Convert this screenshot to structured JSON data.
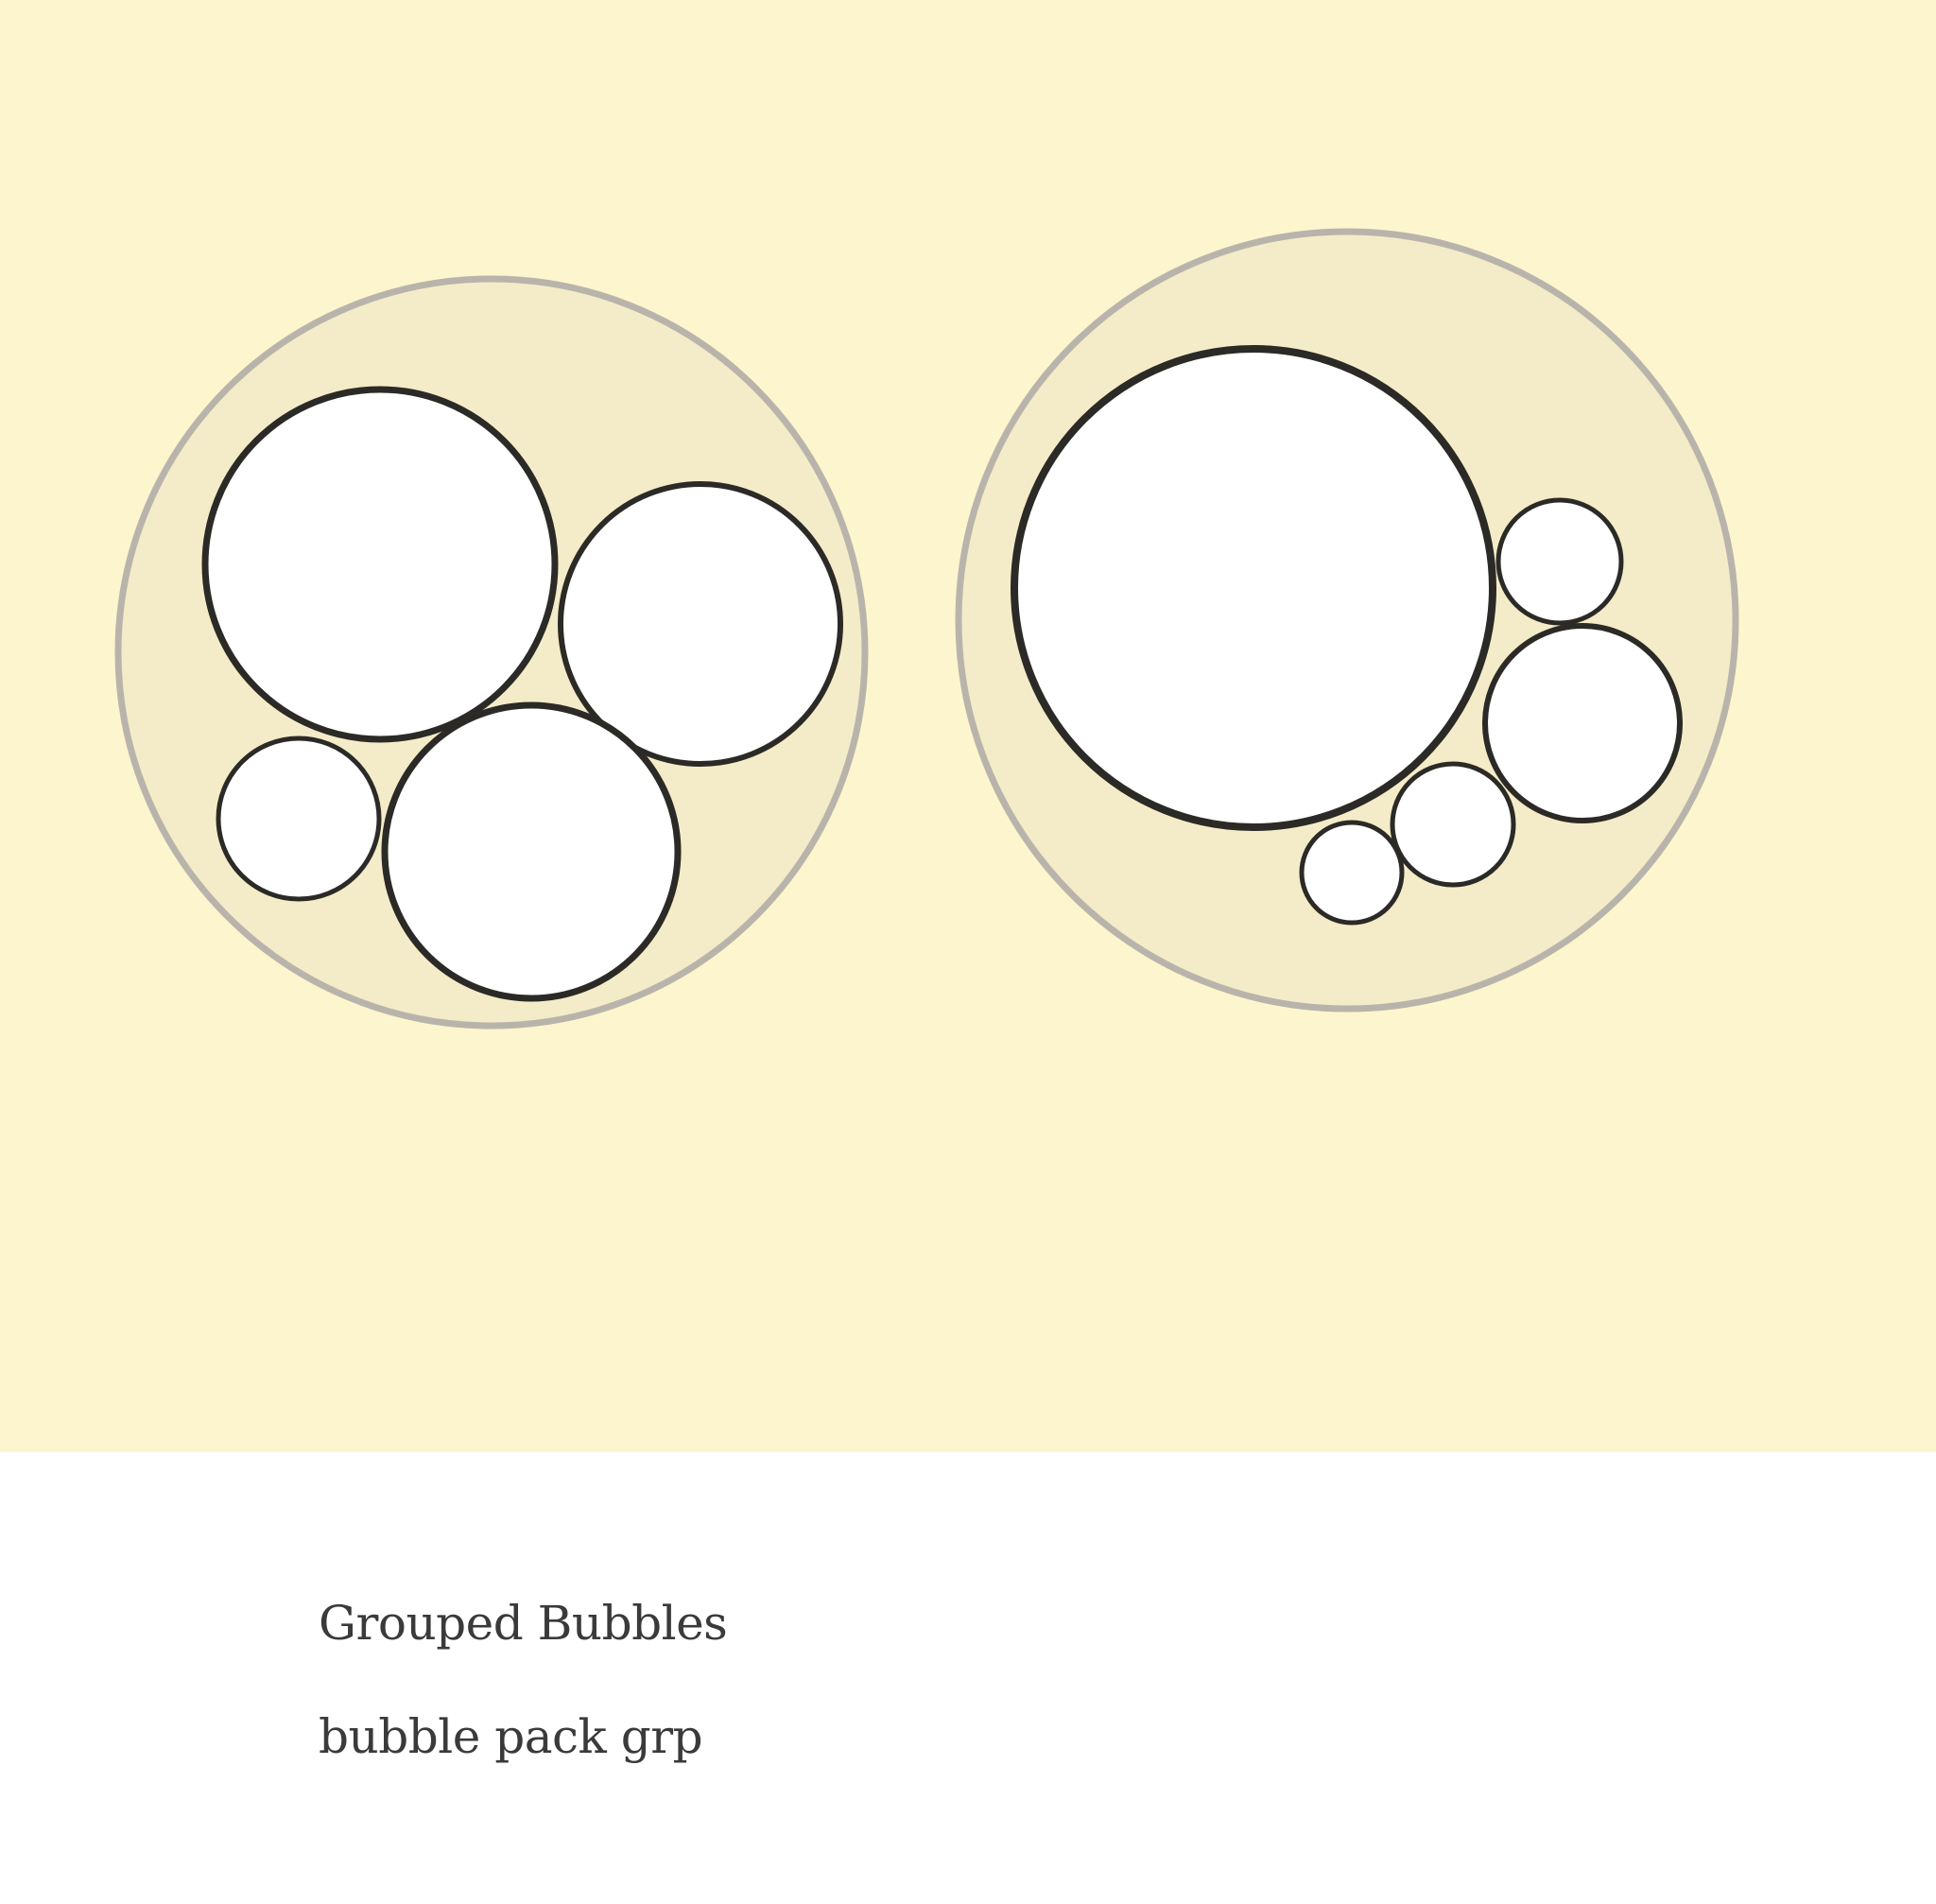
{
  "caption": {
    "title": "Grouped Bubbles",
    "subtitle": "bubble pack grp"
  },
  "colors": {
    "background": "#fdf5cd",
    "group_fill": "#f4ecc8",
    "group_stroke": "#b9b4ab",
    "bubble_fill": "#ffffff",
    "bubble_stroke": "#2b2a26",
    "text": "#3a3a3a"
  }
}
